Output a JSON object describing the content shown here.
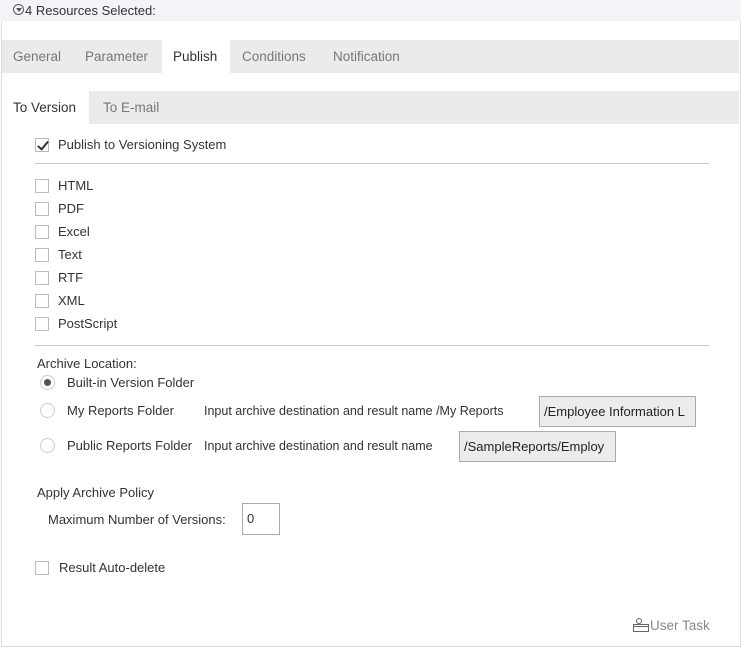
{
  "header": {
    "title": "4 Resources Selected:"
  },
  "tabs": [
    {
      "label": "General"
    },
    {
      "label": "Parameter"
    },
    {
      "label": "Publish",
      "active": true
    },
    {
      "label": "Conditions"
    },
    {
      "label": "Notification"
    }
  ],
  "subtabs": [
    {
      "label": "To Version",
      "active": true
    },
    {
      "label": "To E-mail"
    }
  ],
  "publish_versioning": {
    "label": "Publish to Versioning System",
    "checked": true
  },
  "formats": [
    {
      "label": "HTML",
      "checked": false
    },
    {
      "label": "PDF",
      "checked": false
    },
    {
      "label": "Excel",
      "checked": false
    },
    {
      "label": "Text",
      "checked": false
    },
    {
      "label": "RTF",
      "checked": false
    },
    {
      "label": "XML",
      "checked": false
    },
    {
      "label": "PostScript",
      "checked": false
    }
  ],
  "archive": {
    "title": "Archive Location:",
    "builtin": {
      "label": "Built-in Version Folder",
      "selected": true
    },
    "my_reports": {
      "label": "My Reports Folder",
      "hint": "Input archive destination and result name /My Reports",
      "value": "/Employee Information L",
      "selected": false
    },
    "public_reports": {
      "label": "Public Reports Folder",
      "hint": "Input archive destination and result name",
      "value": "/SampleReports/Employ",
      "selected": false
    }
  },
  "policy": {
    "title": "Apply Archive Policy",
    "max_label": "Maximum Number of Versions:",
    "max_value": "0"
  },
  "auto_delete": {
    "label": "Result Auto-delete",
    "checked": false
  },
  "footer": {
    "user_task": "User Task"
  }
}
